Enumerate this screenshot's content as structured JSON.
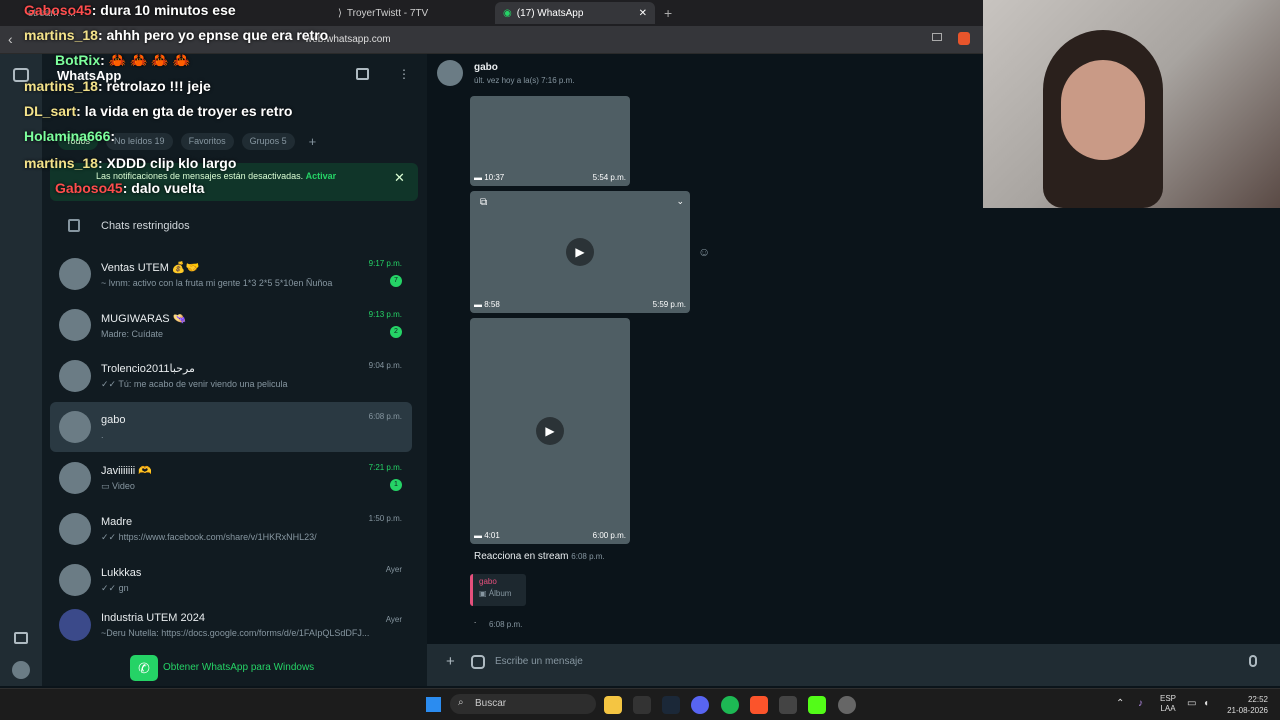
{
  "browser": {
    "tabs": [
      {
        "label": "stream - ..."
      },
      {
        "label": "TroyerTwistt - 7TV"
      },
      {
        "label": "(17) WhatsApp"
      }
    ],
    "url": "web.whatsapp.com"
  },
  "whatsapp": {
    "title": "WhatsApp",
    "filters": [
      "Todos",
      "No leídos 19",
      "Favoritos",
      "Grupos 5"
    ],
    "notice": {
      "text": "Las notificaciones de mensajes están desactivadas.",
      "action": "Activar"
    },
    "restricted": "Chats restringidos",
    "chats": [
      {
        "name": "Ventas UTEM 💰🤝",
        "msg": "~ lvnm: activo con la fruta mi gente 1*3 2*5 5*10en Ñuñoa",
        "time": "9:17 p.m.",
        "unread": "7"
      },
      {
        "name": "MUGIWARAS 👒",
        "msg": "Madre: Cuídate",
        "time": "9:13 p.m.",
        "unread": "2"
      },
      {
        "name": "Trolencio2011مرحبا",
        "msg": "✓✓ Tú: me acabo de venir viendo una pelicula",
        "time": "9:04 p.m.",
        "unread": ""
      },
      {
        "name": "gabo",
        "msg": ".",
        "time": "6:08 p.m.",
        "unread": ""
      },
      {
        "name": "Javiiiiiii 🫶",
        "msg": "Video",
        "time": "7:21 p.m.",
        "unread": "1"
      },
      {
        "name": "Madre",
        "msg": "✓✓ https://www.facebook.com/share/v/1HKRxNHL23/",
        "time": "1:50 p.m.",
        "unread": ""
      },
      {
        "name": "Lukkkas",
        "msg": "✓✓ gn",
        "time": "Ayer",
        "unread": ""
      },
      {
        "name": "Industria UTEM 2024",
        "msg": "~Deru Nutella: https://docs.google.com/forms/d/e/1FAIpQLSdDFJ...",
        "time": "Ayer",
        "unread": ""
      }
    ],
    "get_app": "Obtener WhatsApp para Windows",
    "conversation": {
      "name": "gabo",
      "last_seen": "últ. vez hoy a la(s) 7:16 p.m.",
      "videos": [
        {
          "duration": "10:37",
          "time": "5:54 p.m."
        },
        {
          "duration": "8:58",
          "time": "5:59 p.m."
        },
        {
          "duration": "4:01",
          "time": "6:00 p.m."
        }
      ],
      "text_msg": {
        "text": "Reacciona en stream",
        "time": "6:08 p.m."
      },
      "reply": {
        "author": "gabo",
        "quoted": "Álbum",
        "text": ".",
        "time": "6:08 p.m."
      },
      "composer_placeholder": "Escribe un mensaje"
    }
  },
  "overlay_chat": [
    {
      "user": "Gaboso45",
      "msg": "dura 10 minutos ese"
    },
    {
      "user": "martins_18",
      "msg": "ahhh pero yo epnse que era retro"
    },
    {
      "user": "BotRix",
      "msg": "🦀 🦀 🦀 🦀"
    },
    {
      "user": "martins_18",
      "msg": "retrolazo !!! jeje"
    },
    {
      "user": "DL_sart",
      "msg": "la vida en gta de troyer es retro"
    },
    {
      "user": "Holamina666",
      "msg": ""
    },
    {
      "user": "martins_18",
      "msg": "XDDD clip klo largo"
    },
    {
      "user": "Gaboso45",
      "msg": "dalo vuelta"
    }
  ],
  "taskbar": {
    "search": "Buscar",
    "lang": "ESP",
    "lang2": "LAA",
    "time": "22:52",
    "date": "21-08-2026"
  }
}
